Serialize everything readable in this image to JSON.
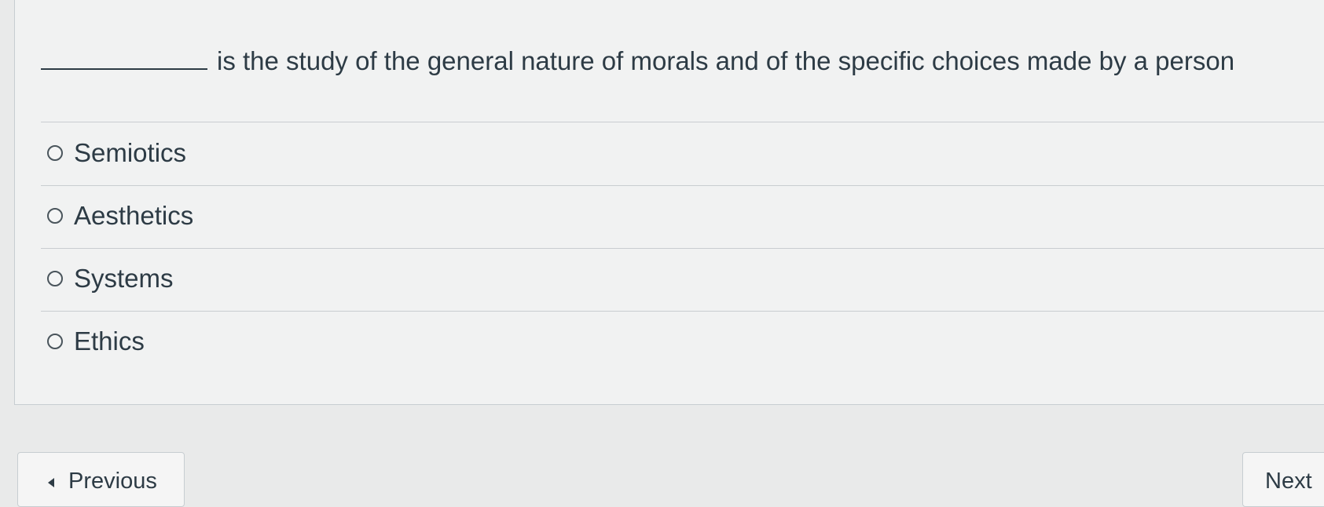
{
  "question": {
    "text": "is the study of the general nature of morals and of the specific choices made by a person"
  },
  "answers": [
    {
      "label": "Semiotics",
      "selected": false
    },
    {
      "label": "Aesthetics",
      "selected": false
    },
    {
      "label": "Systems",
      "selected": false
    },
    {
      "label": "Ethics",
      "selected": false
    }
  ],
  "navigation": {
    "previous_label": "Previous",
    "next_label": "Next"
  },
  "colors": {
    "text": "#2d3b45",
    "background": "#e9eaea",
    "panel": "#f1f2f2",
    "divider": "#c9cdd0"
  },
  "icons": {
    "previous": "caret-left-icon",
    "answer_marker": "radio-icon"
  }
}
